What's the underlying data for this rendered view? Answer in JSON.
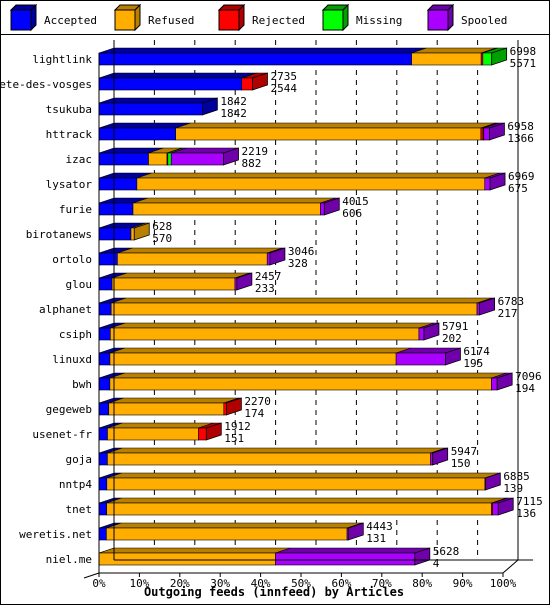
{
  "chart_data": {
    "type": "bar",
    "orientation": "horizontal",
    "stacked": true,
    "style": "3d",
    "title": "",
    "xlabel": "Outgoing feeds (innfeed) by Articles",
    "ylabel": "",
    "xlim": [
      0,
      100
    ],
    "x_tick_labels": [
      "0%",
      "10%",
      "20%",
      "30%",
      "40%",
      "50%",
      "60%",
      "70%",
      "80%",
      "90%",
      "100%"
    ],
    "grid": "vertical dashed",
    "legend_position": "top",
    "scale_max_articles": 7200,
    "legend": [
      {
        "name": "Accepted",
        "color": "#0000ff",
        "dark": "#00009c"
      },
      {
        "name": "Refused",
        "color": "#ffae00",
        "dark": "#b98000"
      },
      {
        "name": "Rejected",
        "color": "#ff0000",
        "dark": "#b00000"
      },
      {
        "name": "Missing",
        "color": "#00ff00",
        "dark": "#00a000"
      },
      {
        "name": "Spooled",
        "color": "#aa00ff",
        "dark": "#7000aa"
      }
    ],
    "categories": [
      "lightlink",
      "bete-des-vosges",
      "tsukuba",
      "httrack",
      "izac",
      "lysator",
      "furie",
      "birotanews",
      "ortolo",
      "glou",
      "alphanet",
      "csiph",
      "linuxd",
      "bwh",
      "gegeweb",
      "usenet-fr",
      "goja",
      "nntp4",
      "tnet",
      "weretis.net",
      "niel.me"
    ],
    "totals": [
      6998,
      2735,
      1842,
      6958,
      2219,
      6969,
      4015,
      628,
      3046,
      2457,
      6783,
      5791,
      6174,
      7096,
      2270,
      1912,
      5947,
      6885,
      7115,
      4443,
      5628
    ],
    "accepted_labels": [
      5571,
      2544,
      1842,
      1366,
      882,
      675,
      606,
      570,
      328,
      233,
      217,
      202,
      195,
      194,
      174,
      151,
      150,
      139,
      136,
      131,
      4
    ],
    "series": [
      {
        "name": "Accepted",
        "values": [
          5571,
          2544,
          1842,
          1366,
          882,
          675,
          606,
          570,
          328,
          233,
          217,
          202,
          195,
          194,
          174,
          151,
          150,
          139,
          136,
          131,
          4
        ]
      },
      {
        "name": "Refused",
        "values": [
          1240,
          0,
          0,
          5440,
          330,
          6200,
          3340,
          58,
          2670,
          2190,
          6520,
          5500,
          5100,
          6800,
          2050,
          1620,
          5760,
          6740,
          6860,
          4290,
          3140
        ]
      },
      {
        "name": "Rejected",
        "values": [
          30,
          191,
          0,
          40,
          15,
          0,
          0,
          0,
          0,
          0,
          0,
          0,
          0,
          0,
          46,
          141,
          0,
          0,
          20,
          0,
          0
        ]
      },
      {
        "name": "Missing",
        "values": [
          157,
          0,
          0,
          12,
          60,
          0,
          0,
          0,
          0,
          0,
          0,
          0,
          0,
          0,
          0,
          0,
          0,
          0,
          0,
          0,
          0
        ]
      },
      {
        "name": "Spooled",
        "values": [
          0,
          0,
          0,
          100,
          932,
          94,
          69,
          0,
          48,
          34,
          46,
          89,
          879,
          102,
          0,
          0,
          37,
          6,
          99,
          22,
          2484
        ]
      }
    ]
  }
}
